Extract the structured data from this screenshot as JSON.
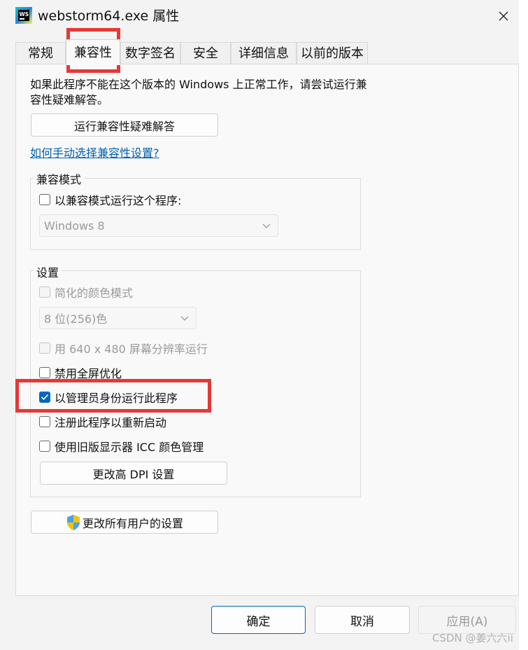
{
  "window": {
    "title": "webstorm64.exe 属性",
    "app_icon_text": "WS",
    "close_glyph": "✕"
  },
  "tabs": [
    {
      "label": "常规",
      "active": false
    },
    {
      "label": "兼容性",
      "active": true
    },
    {
      "label": "数字签名",
      "active": false
    },
    {
      "label": "安全",
      "active": false
    },
    {
      "label": "详细信息",
      "active": false
    },
    {
      "label": "以前的版本",
      "active": false
    }
  ],
  "compat": {
    "description": "如果此程序不能在这个版本的 Windows 上正常工作，请尝试运行兼容性疑难解答。",
    "troubleshoot_button": "运行兼容性疑难解答",
    "manual_link": "如何手动选择兼容性设置?",
    "mode_group": {
      "label": "兼容模式",
      "checkbox_label": "以兼容模式运行这个程序:",
      "checked": false,
      "os_select": "Windows 8"
    },
    "settings_group": {
      "label": "设置",
      "reduced_color": {
        "label": "简化的颜色模式",
        "checked": false,
        "disabled": true
      },
      "color_select": "8 位(256)色",
      "res_640": {
        "label": "用 640 x 480 屏幕分辨率运行",
        "checked": false,
        "disabled": true
      },
      "disable_fullscreen": {
        "label": "禁用全屏优化",
        "checked": false,
        "disabled": false
      },
      "run_as_admin": {
        "label": "以管理员身份运行此程序",
        "checked": true,
        "disabled": false
      },
      "register_restart": {
        "label": "注册此程序以重新启动",
        "checked": false,
        "disabled": false
      },
      "legacy_icc": {
        "label": "使用旧版显示器 ICC 颜色管理",
        "checked": false,
        "disabled": false
      },
      "dpi_button": "更改高 DPI 设置"
    },
    "all_users_button": "更改所有用户的设置"
  },
  "footer": {
    "ok": "确定",
    "cancel": "取消",
    "apply": "应用(A)"
  },
  "watermark": "CSDN @姜六六ii",
  "colors": {
    "accent": "#0067c0",
    "highlight": "#e53935",
    "link": "#0060b0"
  }
}
